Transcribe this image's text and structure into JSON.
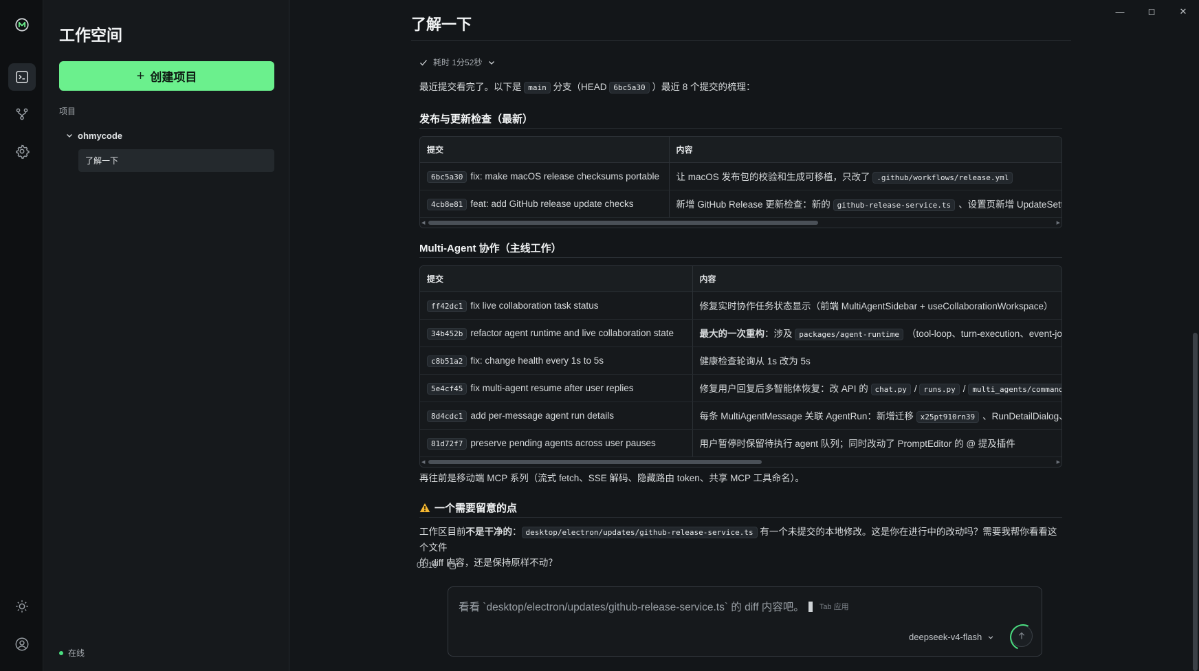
{
  "window": {
    "minimize": "—",
    "maximize": "◻",
    "close": "✕"
  },
  "rail": {
    "items": [
      "logo-icon",
      "terminal-icon",
      "branch-icon",
      "gear-icon",
      "sun-icon",
      "user-icon"
    ],
    "active": "terminal-icon"
  },
  "sidebar": {
    "title": "工作空间",
    "create_button": "创建项目",
    "projects_heading": "项目",
    "project_name": "ohmycode",
    "conversation": "了解一下",
    "status": "在线"
  },
  "main": {
    "title": "了解一下",
    "duration": "耗时 1分52秒",
    "intro": {
      "part1": "最近提交看完了。以下是",
      "branch": "main",
      "part2": "分支（HEAD",
      "head": "6bc5a30",
      "part3": "）最近 8 个提交的梳理："
    },
    "section1": {
      "title": "发布与更新检查（最新）",
      "columns": [
        "提交",
        "内容"
      ],
      "rows": [
        {
          "hash": "6bc5a30",
          "msg": "fix: make macOS release checksums portable",
          "content": "让 macOS 发布包的校验和生成可移植，只改了",
          "code": ".github/workflows/release.yml",
          "tail": ""
        },
        {
          "hash": "4cb8e81",
          "msg": "feat: add GitHub release update checks",
          "content": "新增 GitHub Release 更新检查：新的",
          "code": "github-release-service.ts",
          "tail": "、设置页新增 UpdateSetting"
        }
      ]
    },
    "section2": {
      "title": "Multi-Agent 协作（主线工作）",
      "columns": [
        "提交",
        "内容"
      ],
      "rows": [
        {
          "hash": "ff42dc1",
          "msg": "fix live collaboration task status",
          "content": "修复实时协作任务状态显示（前端 MultiAgentSidebar + useCollaborationWorkspace）"
        },
        {
          "hash": "34b452b",
          "msg": "refactor agent runtime and live collaboration state",
          "bold": "最大的一次重构",
          "content": "：涉及",
          "code": "packages/agent-runtime",
          "tail": "（tool-loop、turn-execution、event-jo"
        },
        {
          "hash": "c8b51a2",
          "msg": "fix: change health every 1s to 5s",
          "content": "健康检查轮询从 1s 改为 5s"
        },
        {
          "hash": "5e4cf45",
          "msg": "fix multi-agent resume after user replies",
          "content": "修复用户回复后多智能体恢复：改 API 的",
          "codes": [
            "chat.py",
            "runs.py",
            "multi_agents/commands.py"
          ],
          "sep": "/"
        },
        {
          "hash": "8d4cdc1",
          "msg": "add per-message agent run details",
          "content": "每条 MultiAgentMessage 关联 AgentRun：新增迁移",
          "code": "x25pt910rn39",
          "tail": "、RunDetailDialog、"
        },
        {
          "hash": "81d72f7",
          "msg": "preserve pending agents across user pauses",
          "content": "用户暂停时保留待执行 agent 队列；同时改动了 PromptEditor 的 @ 提及插件"
        }
      ]
    },
    "earlier": "再往前是移动端 MCP 系列（流式 fetch、SSE 解码、隐藏路由 token、共享 MCP 工具命名）。",
    "warning": {
      "title": "一个需要留意的点",
      "prefix": "工作区目前",
      "bold": "不是干净的",
      "colon": "：",
      "path": "desktop/electron/updates/github-release-service.ts",
      "line1_rest": "有一个未提交的本地修改。这是你在进行中的改动吗？需要我帮你看看这个文件",
      "line2": "的 diff 内容，还是保持原样不动？"
    },
    "time": "01:16"
  },
  "composer": {
    "placeholder": "看看 `desktop/electron/updates/github-release-service.ts` 的 diff 内容吧。",
    "tab_hint": "Tab 应用",
    "model": "deepseek-v4-flash"
  },
  "colors": {
    "accent": "#6bf08d",
    "online": "#4ade80",
    "warn": "#f5b731"
  }
}
